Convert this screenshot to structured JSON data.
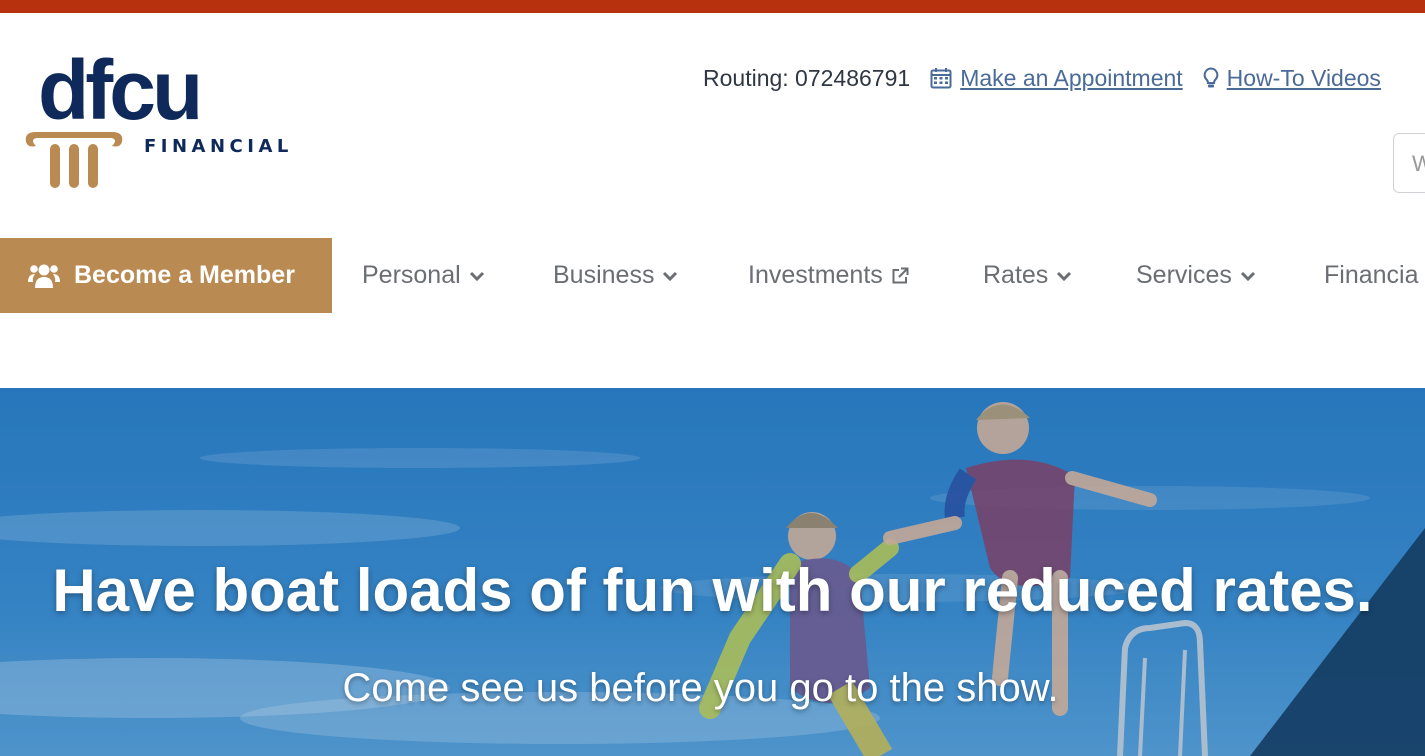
{
  "colors": {
    "top_strip": "#b8310f",
    "brand_navy": "#0f2a5a",
    "brand_gold": "#b98a52",
    "link_blue": "#4a6a98",
    "nav_text": "#6b6e72",
    "member_bg": "#b98a52",
    "hero_sky": "#2e7fc0"
  },
  "logo": {
    "word": "dfcu",
    "sub": "FINANCIAL",
    "icon": "pillar-icon"
  },
  "utility": {
    "routing": "Routing: 072486791",
    "appointment": {
      "label": "Make an Appointment",
      "icon": "calendar-icon"
    },
    "videos": {
      "label": "How-To Videos",
      "icon": "lightbulb-icon"
    }
  },
  "search": {
    "placeholder": "W"
  },
  "nav": {
    "member_button": {
      "label": "Become a Member",
      "icon": "users-icon"
    },
    "items": [
      {
        "label": "Personal",
        "icon": "chevron-down-icon"
      },
      {
        "label": "Business",
        "icon": "chevron-down-icon"
      },
      {
        "label": "Investments",
        "icon": "external-link-icon"
      },
      {
        "label": "Rates",
        "icon": "chevron-down-icon"
      },
      {
        "label": "Services",
        "icon": "chevron-down-icon"
      },
      {
        "label": "Financia"
      }
    ]
  },
  "hero": {
    "title": "Have boat loads of fun with our reduced rates.",
    "subtitle": "Come see us before you go to the show."
  }
}
